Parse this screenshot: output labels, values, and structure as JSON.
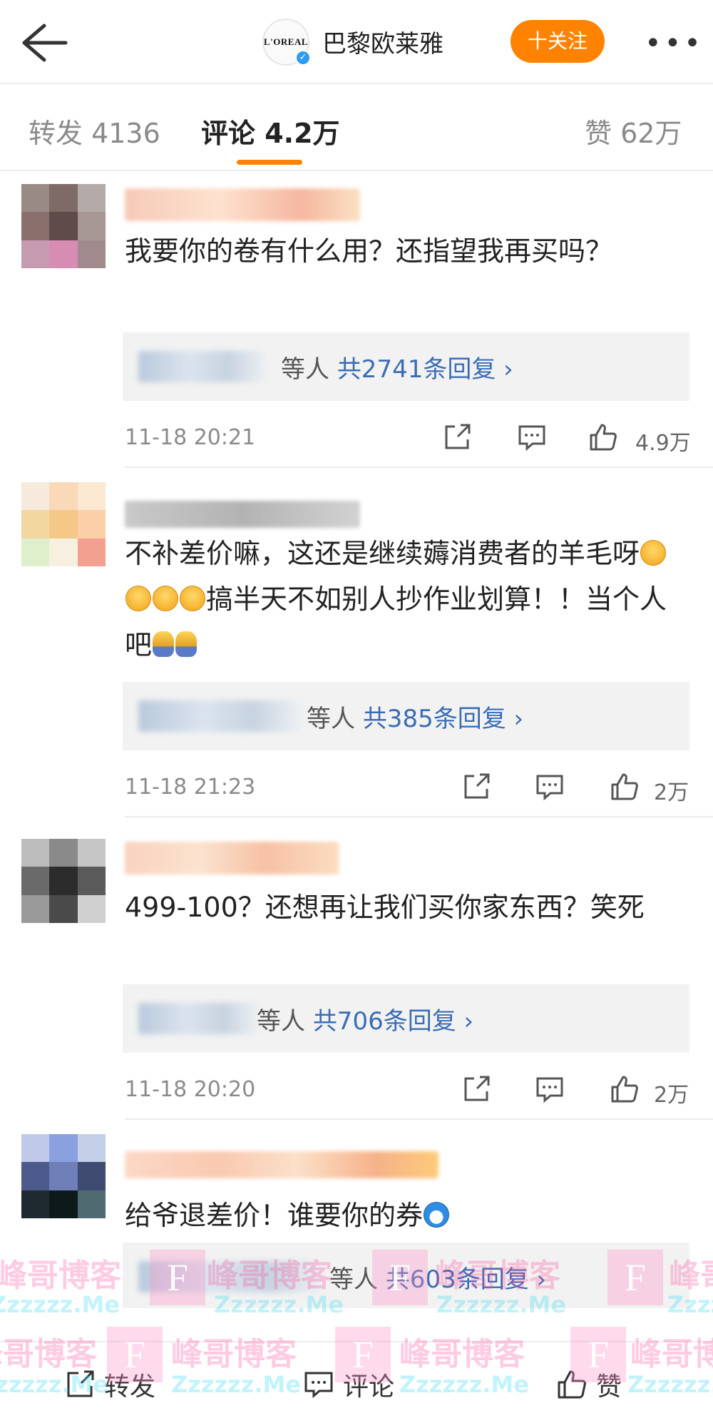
{
  "header": {
    "brand_name": "巴黎欧莱雅",
    "logo_text": "L'OREAL",
    "follow_label": "十关注",
    "more_label": "•••",
    "accent_color": "#ff8200"
  },
  "tabs": [
    {
      "label": "转发 4136",
      "active": false
    },
    {
      "label": "评论 4.2万",
      "active": true
    },
    {
      "label": "赞 62万",
      "active": false
    }
  ],
  "comments": [
    {
      "text": "我要你的卷有什么用？还指望我再买吗？",
      "reply_suffix": "等人",
      "reply_link": "共2741条回复 ›",
      "time": "11-18 20:21",
      "likes": "4.9万"
    },
    {
      "text_parts": [
        "不补差价嘛，这还是继续薅消费者的羊毛呀",
        "搞半天不如别人抄作业划算！！当个人吧"
      ],
      "reply_suffix": "等人",
      "reply_link": "共385条回复 ›",
      "time": "11-18 21:23",
      "likes": "2万"
    },
    {
      "text": "499-100？还想再让我们买你家东西？笑死",
      "reply_suffix": "等人",
      "reply_link": "共706条回复 ›",
      "time": "11-18 20:20",
      "likes": "2万"
    },
    {
      "text": "给爷退差价！谁要你的券",
      "reply_suffix": "等人",
      "reply_link": "共603条回复 ›",
      "time": "",
      "likes": ""
    }
  ],
  "bottom_bar": {
    "repost_label": "转发",
    "comment_label": "评论",
    "like_label": "赞"
  },
  "watermark": {
    "text": "峰哥博客",
    "sub_text": "Zzzzzz.Me",
    "box_letter": "F"
  }
}
